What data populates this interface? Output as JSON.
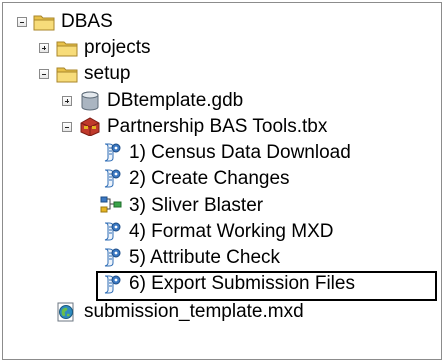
{
  "tree": {
    "root": {
      "label": "DBAS",
      "icon": "folder-icon",
      "expanded": true
    },
    "projects": {
      "label": "projects",
      "icon": "folder-icon",
      "expanded": false
    },
    "setup": {
      "label": "setup",
      "icon": "folder-icon",
      "expanded": true
    },
    "dbtemplate": {
      "label": "DBtemplate.gdb",
      "icon": "database-icon",
      "expanded": false
    },
    "toolbox": {
      "label": "Partnership BAS Tools.tbx",
      "icon": "toolbox-icon",
      "expanded": true
    },
    "tools": [
      {
        "label": "1) Census Data Download",
        "icon": "script-tool-icon"
      },
      {
        "label": "2) Create Changes",
        "icon": "script-tool-icon"
      },
      {
        "label": "3) Sliver Blaster",
        "icon": "model-tool-icon"
      },
      {
        "label": "4) Format Working MXD",
        "icon": "script-tool-icon"
      },
      {
        "label": "5) Attribute Check",
        "icon": "script-tool-icon"
      },
      {
        "label": "6) Export Submission Files",
        "icon": "script-tool-icon",
        "highlighted": true
      }
    ],
    "mxd": {
      "label": "submission_template.mxd",
      "icon": "map-document-icon"
    }
  }
}
